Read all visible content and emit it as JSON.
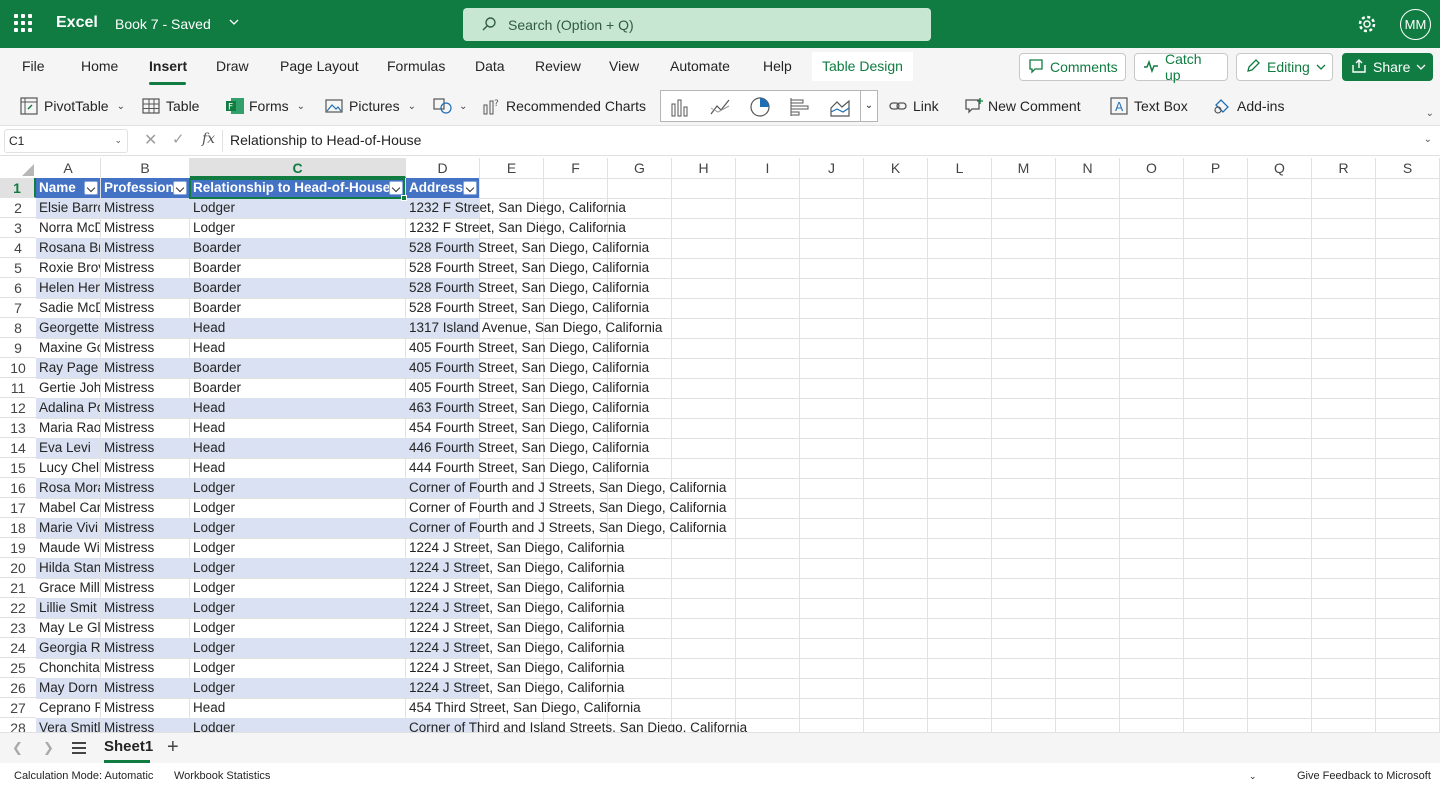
{
  "app": {
    "name": "Excel",
    "doc_title": "Book 7  -  Saved",
    "search_placeholder": "Search (Option + Q)",
    "user_initials": "MM"
  },
  "menu": {
    "tabs": [
      "File",
      "Home",
      "Insert",
      "Draw",
      "Page Layout",
      "Formulas",
      "Data",
      "Review",
      "View",
      "Automate",
      "Help"
    ],
    "active_tab": "Insert",
    "table_design": "Table Design",
    "comments": "Comments",
    "catch_up": "Catch up",
    "editing": "Editing",
    "share": "Share"
  },
  "ribbon": {
    "pivot_table": "PivotTable",
    "table": "Table",
    "forms": "Forms",
    "pictures": "Pictures",
    "recommended_charts": "Recommended Charts",
    "link": "Link",
    "new_comment": "New Comment",
    "text_box": "Text Box",
    "add_ins": "Add-ins",
    "chart_gallery": [
      "column-chart-icon",
      "line-chart-icon",
      "pie-chart-icon",
      "bar-chart-icon",
      "area-chart-icon"
    ]
  },
  "formula_bar": {
    "name_box": "C1",
    "fx": "fx",
    "content": "Relationship to Head-of-House"
  },
  "grid": {
    "columns": [
      "A",
      "B",
      "C",
      "D",
      "E",
      "F",
      "G",
      "H",
      "I",
      "J",
      "K",
      "L",
      "M",
      "N",
      "O",
      "P",
      "Q",
      "R",
      "S"
    ],
    "selected_column": "C",
    "selected_row": "1",
    "headers": [
      "Name",
      "Profession",
      "Relationship to Head-of-House",
      "Address"
    ],
    "rows": [
      [
        "2",
        "Elsie Barrc",
        "Mistress",
        "Lodger",
        "1232 F Street, San Diego, California"
      ],
      [
        "3",
        "Norra McD",
        "Mistress",
        "Lodger",
        "1232 F Street, San Diego, California"
      ],
      [
        "4",
        "Rosana Br",
        "Mistress",
        "Boarder",
        "528 Fourth Street, San Diego, California"
      ],
      [
        "5",
        "Roxie Brov",
        "Mistress",
        "Boarder",
        "528 Fourth Street, San Diego, California"
      ],
      [
        "6",
        "Helen Hen",
        "Mistress",
        "Boarder",
        "528 Fourth Street, San Diego, California"
      ],
      [
        "7",
        "Sadie McD",
        "Mistress",
        "Boarder",
        "528 Fourth Street, San Diego, California"
      ],
      [
        "8",
        "Georgette",
        "Mistress",
        "Head",
        "1317 Island Avenue, San Diego, California"
      ],
      [
        "9",
        "Maxine Gc",
        "Mistress",
        "Head",
        "405 Fourth Street, San Diego, California"
      ],
      [
        "10",
        "Ray Page",
        "Mistress",
        "Boarder",
        "405 Fourth Street, San Diego, California"
      ],
      [
        "11",
        "Gertie Joh",
        "Mistress",
        "Boarder",
        "405 Fourth Street, San Diego, California"
      ],
      [
        "12",
        "Adalina Pc",
        "Mistress",
        "Head",
        "463 Fourth Street, San Diego, California"
      ],
      [
        "13",
        "Maria Rao",
        "Mistress",
        "Head",
        "454 Fourth Street, San Diego, California"
      ],
      [
        "14",
        "Eva Levi",
        "Mistress",
        "Head",
        "446 Fourth Street, San Diego, California"
      ],
      [
        "15",
        "Lucy Chell",
        "Mistress",
        "Head",
        "444 Fourth Street, San Diego, California"
      ],
      [
        "16",
        "Rosa Mora",
        "Mistress",
        "Lodger",
        "Corner of Fourth and J Streets, San Diego, California"
      ],
      [
        "17",
        "Mabel Car",
        "Mistress",
        "Lodger",
        "Corner of Fourth and J Streets, San Diego, California"
      ],
      [
        "18",
        "Marie Vivi",
        "Mistress",
        "Lodger",
        "Corner of Fourth and J Streets, San Diego, California"
      ],
      [
        "19",
        "Maude Wi",
        "Mistress",
        "Lodger",
        "1224 J Street, San Diego, California"
      ],
      [
        "20",
        "Hilda Stan",
        "Mistress",
        "Lodger",
        "1224 J Street, San Diego, California"
      ],
      [
        "21",
        "Grace Mill",
        "Mistress",
        "Lodger",
        "1224 J Street, San Diego, California"
      ],
      [
        "22",
        "Lillie Smit",
        "Mistress",
        "Lodger",
        "1224 J Street, San Diego, California"
      ],
      [
        "23",
        "May Le Gli",
        "Mistress",
        "Lodger",
        "1224 J Street, San Diego, California"
      ],
      [
        "24",
        "Georgia Ra",
        "Mistress",
        "Lodger",
        "1224 J Street, San Diego, California"
      ],
      [
        "25",
        "Chonchita",
        "Mistress",
        "Lodger",
        "1224 J Street, San Diego, California"
      ],
      [
        "26",
        "May Dorn",
        "Mistress",
        "Lodger",
        "1224 J Street, San Diego, California"
      ],
      [
        "27",
        "Ceprano R",
        "Mistress",
        "Head",
        "454 Third Street, San Diego, California"
      ],
      [
        "28",
        "Vera Smitl",
        "Mistress",
        "Lodger",
        "Corner of Third and Island Streets, San Diego, California"
      ]
    ]
  },
  "sheets": {
    "active": "Sheet1",
    "add": "+"
  },
  "status": {
    "calc_mode": "Calculation Mode: Automatic",
    "workbook_stats": "Workbook Statistics",
    "feedback": "Give Feedback to Microsoft"
  },
  "colors": {
    "brand": "#107c41",
    "table_header": "#4472c4",
    "table_band": "#d9e1f2"
  }
}
